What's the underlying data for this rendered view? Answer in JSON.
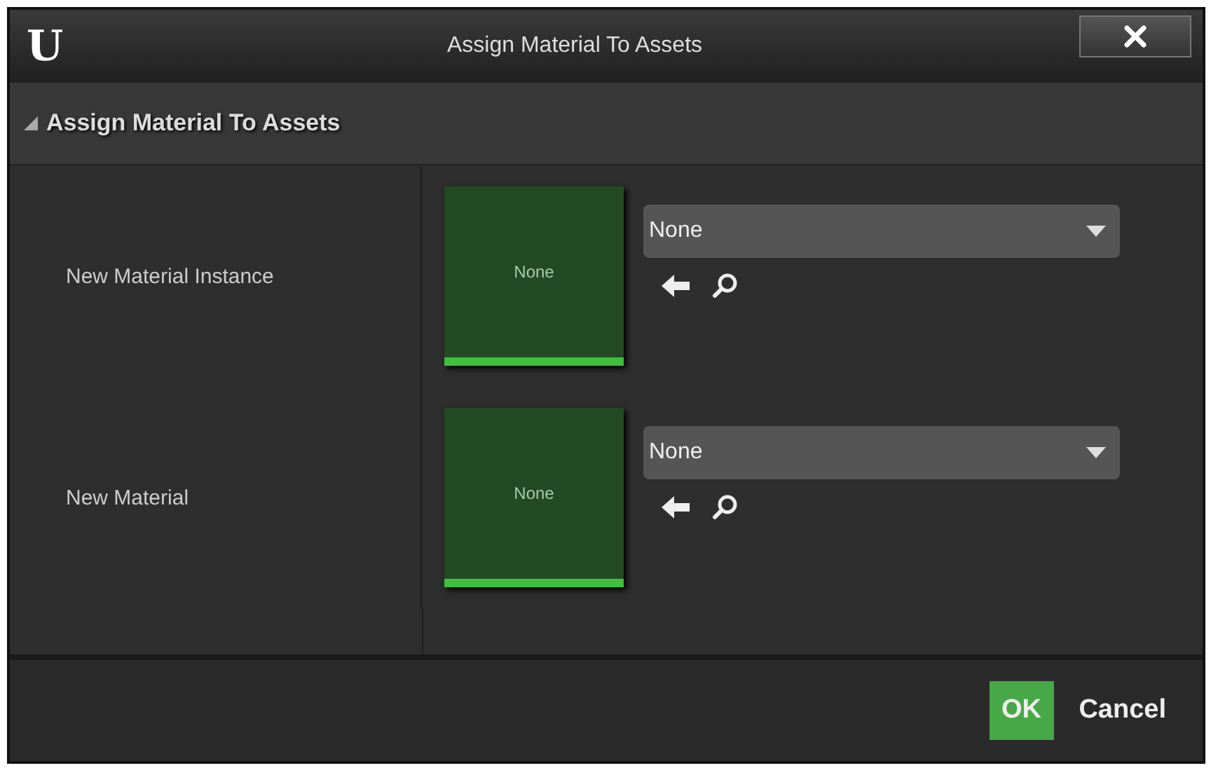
{
  "window": {
    "logo": "U",
    "title": "Assign Material To Assets"
  },
  "section": {
    "title": "Assign Material To Assets",
    "expanded": true
  },
  "properties": [
    {
      "label": "New Material Instance",
      "thumbnail": "None",
      "value": "None"
    },
    {
      "label": "New Material",
      "thumbnail": "None",
      "value": "None"
    }
  ],
  "buttons": [
    {
      "label": "OK",
      "kind": "primary"
    },
    {
      "label": "Cancel",
      "kind": "plain"
    }
  ]
}
